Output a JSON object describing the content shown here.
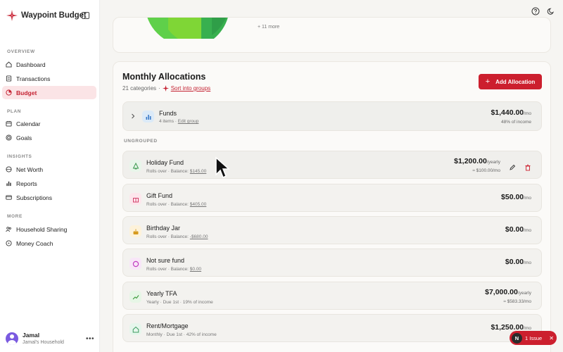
{
  "app": {
    "name": "Waypoint Budget"
  },
  "sidebar": {
    "sections": [
      {
        "label": "OVERVIEW",
        "items": [
          {
            "label": "Dashboard",
            "icon": "house-icon"
          },
          {
            "label": "Transactions",
            "icon": "receipt-icon"
          },
          {
            "label": "Budget",
            "icon": "pie-icon",
            "active": true
          }
        ]
      },
      {
        "label": "PLAN",
        "items": [
          {
            "label": "Calendar",
            "icon": "calendar-icon"
          },
          {
            "label": "Goals",
            "icon": "target-icon"
          }
        ]
      },
      {
        "label": "INSIGHTS",
        "items": [
          {
            "label": "Net Worth",
            "icon": "globe-icon"
          },
          {
            "label": "Reports",
            "icon": "bar-chart-icon"
          },
          {
            "label": "Subscriptions",
            "icon": "card-icon"
          }
        ]
      },
      {
        "label": "MORE",
        "items": [
          {
            "label": "Household Sharing",
            "icon": "people-icon"
          },
          {
            "label": "Money Coach",
            "icon": "chat-icon"
          }
        ]
      }
    ],
    "user": {
      "name": "Jamal",
      "household": "Jamal's Household",
      "more": "•••"
    }
  },
  "top_card": {
    "more_text": "+ 11 more"
  },
  "allocations": {
    "title": "Monthly Allocations",
    "count": "21 categories",
    "separator": "·",
    "sort_link": "Sort into groups",
    "add_button": "Add Allocation",
    "add_plus": "+",
    "group": {
      "name": "Funds",
      "items": "4 items",
      "sep": "·",
      "edit": "Edit group",
      "amount": "$1,440.00",
      "per": "/mo",
      "income": "48% of income"
    },
    "ungrouped_label": "UNGROUPED",
    "rows": [
      {
        "name": "Holiday Fund",
        "meta_a": "Rolls over · Balance: ",
        "meta_b": "$145.00",
        "amount": "$1,200.00",
        "per": "/yearly",
        "sub": "≈ $100.00/mo",
        "icon": "bell-icon",
        "icon_color": "#e8f6ea",
        "icon_stroke": "#3a9a4e"
      },
      {
        "name": "Gift Fund",
        "meta_a": "Rolls over · Balance: ",
        "meta_b": "$405.00",
        "amount": "$50.00",
        "per": "/mo",
        "sub": "",
        "icon": "gift-icon",
        "icon_color": "#fde6ec",
        "icon_stroke": "#d2406a"
      },
      {
        "name": "Birthday Jar",
        "meta_a": "Rolls over · Balance: ",
        "meta_b": "-$680.00",
        "amount": "$0.00",
        "per": "/mo",
        "sub": "",
        "icon": "cake-icon",
        "icon_color": "#fdf2da",
        "icon_stroke": "#d69a1e"
      },
      {
        "name": "Not sure fund",
        "meta_a": "Rolls over · Balance: ",
        "meta_b": "$0.00",
        "amount": "$0.00",
        "per": "/mo",
        "sub": "",
        "icon": "circle-icon",
        "icon_color": "#f8e6f8",
        "icon_stroke": "#c23cc2"
      },
      {
        "name": "Yearly TFA",
        "meta_a": "Yearly · Due 1st · 19% of income",
        "meta_b": "",
        "amount": "$7,000.00",
        "per": "/yearly",
        "sub": "≈ $583.33/mo",
        "icon": "trending-up-icon",
        "icon_color": "#e6f6e6",
        "icon_stroke": "#3b9a3b"
      },
      {
        "name": "Rent/Mortgage",
        "meta_a": "Monthly · Due 1st · 42% of income",
        "meta_b": "",
        "amount": "$1,250.00",
        "per": "/mo",
        "sub": "",
        "icon": "home-icon",
        "icon_color": "#e6f6ec",
        "icon_stroke": "#3b9a5e"
      }
    ]
  },
  "issue_badge": {
    "letter": "N",
    "label": "1 Issue",
    "close": "✕"
  },
  "colors": {
    "accent": "#cc1f2e",
    "active_bg": "#fbe4e6"
  }
}
